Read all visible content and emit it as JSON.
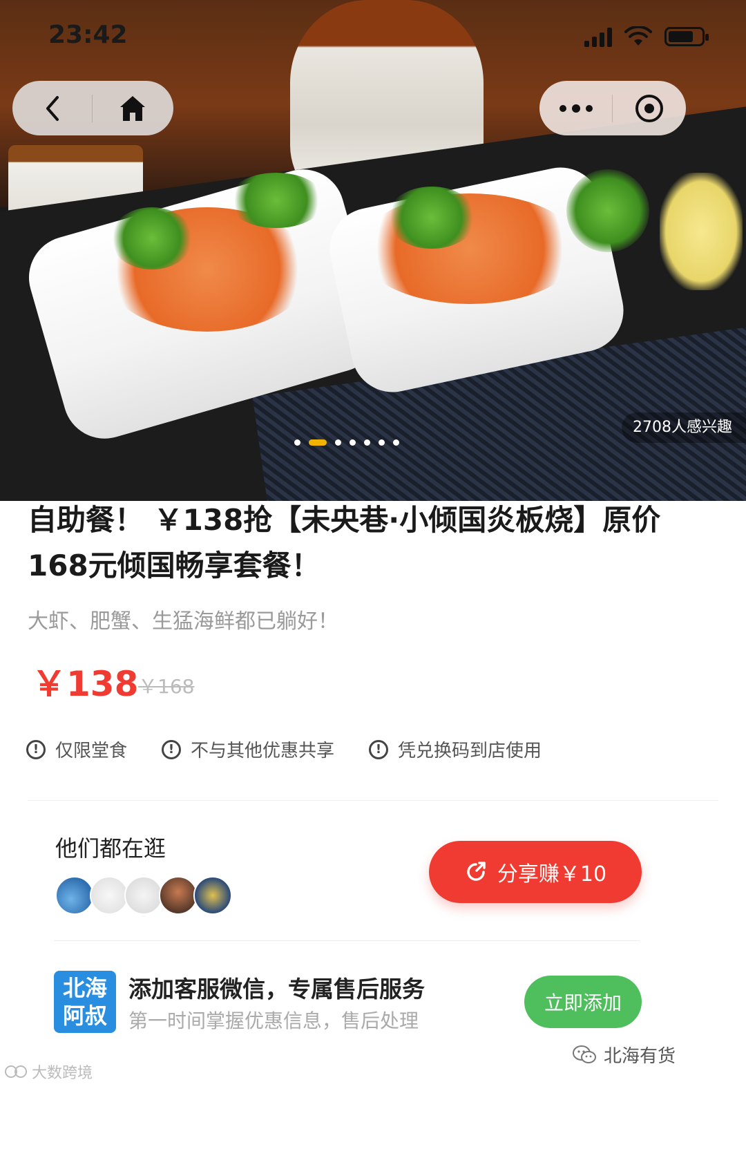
{
  "status_bar": {
    "time": "23:42"
  },
  "hero": {
    "interest_badge": "2708人感兴趣",
    "carousel": {
      "total": 8,
      "active_index": 1
    }
  },
  "product": {
    "title": "自助餐！ ￥138抢【未央巷·小倾国炎板烧】原价168元倾国畅享套餐！",
    "subtitle": "大虾、肥蟹、生猛海鲜都已躺好！",
    "price": "￥138",
    "original_price": "￥168",
    "accent_color": "#ef3b32"
  },
  "tags": [
    {
      "icon": "exclamation-circle-icon",
      "label": "仅限堂食"
    },
    {
      "icon": "exclamation-circle-icon",
      "label": "不与其他优惠共享"
    },
    {
      "icon": "exclamation-circle-icon",
      "label": "凭兑换码到店使用"
    }
  ],
  "browsing": {
    "label": "他们都在逛",
    "avatar_count": 5
  },
  "share_button": {
    "label": "分享赚￥10",
    "color": "#ef3b32"
  },
  "customer_service": {
    "logo_line1": "北海",
    "logo_line2": "阿叔",
    "title": "添加客服微信，专属售后服务",
    "subtitle": "第一时间掌握优惠信息，售后处理",
    "button_label": "立即添加",
    "button_color": "#4fbf5e"
  },
  "watermarks": {
    "left": "大数跨境",
    "right": "北海有货"
  }
}
